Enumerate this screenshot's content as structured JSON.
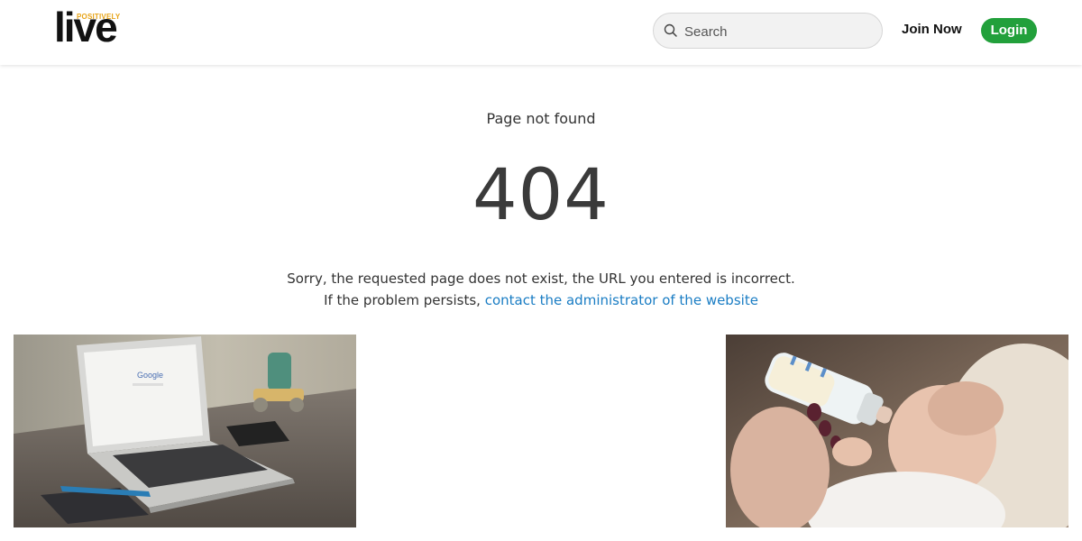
{
  "header": {
    "logo_small": "POSITIVELY",
    "logo_main": "live",
    "search_placeholder": "Search",
    "join_label": "Join Now",
    "login_label": "Login"
  },
  "main": {
    "title": "Page not found",
    "code": "404",
    "line1": "Sorry, the requested page does not exist, the URL you entered is incorrect.",
    "line2_prefix": "If the problem persists, ",
    "line2_link": "contact the administrator of the website"
  },
  "images": {
    "left": {
      "screen_text": "Google"
    }
  },
  "colors": {
    "accent_green": "#22a03b",
    "link_blue": "#1a7dc4",
    "logo_yellow": "#e8a417"
  },
  "icons": [
    "search-icon"
  ]
}
